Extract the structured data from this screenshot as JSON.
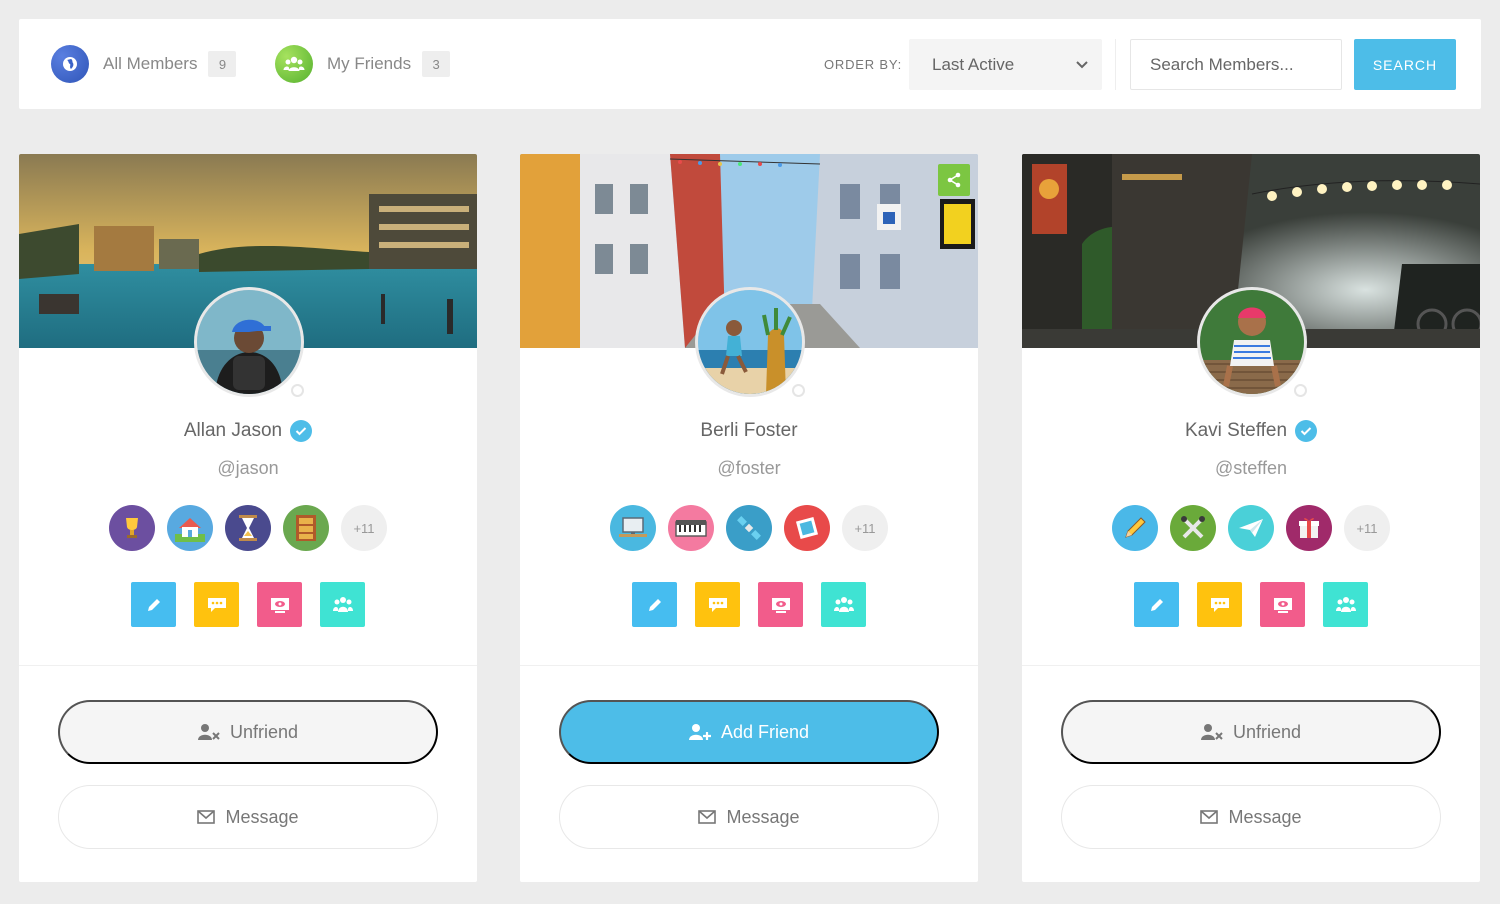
{
  "tabs": {
    "all": {
      "label": "All Members",
      "count": "9",
      "icon": "globe-icon"
    },
    "friends": {
      "label": "My Friends",
      "count": "3",
      "icon": "users-icon"
    }
  },
  "toolbar": {
    "order_label": "ORDER BY:",
    "order_value": "Last Active",
    "search_placeholder": "Search Members...",
    "search_label": "SEARCH"
  },
  "colors": {
    "accent": "#4dbde8",
    "action_blue": "#46bdf0",
    "action_yellow": "#ffc20e",
    "action_pink": "#f25c8b",
    "action_teal": "#3fe3d3"
  },
  "members": [
    {
      "name": "Allan Jason",
      "handle": "@jason",
      "verified": true,
      "badges": [
        "trophy-badge",
        "house-badge",
        "hourglass-badge",
        "bookshelf-badge"
      ],
      "more_badges": "+11",
      "primary_action": "Unfriend",
      "secondary_action": "Message"
    },
    {
      "name": "Berli Foster",
      "handle": "@foster",
      "verified": false,
      "badges": [
        "computer-badge",
        "keyboard-badge",
        "satellite-badge",
        "stamp-badge"
      ],
      "more_badges": "+11",
      "primary_action": "Add Friend",
      "secondary_action": "Message"
    },
    {
      "name": "Kavi Steffen",
      "handle": "@steffen",
      "verified": true,
      "badges": [
        "pencil-badge",
        "tools-badge",
        "paper-plane-badge",
        "gift-badge"
      ],
      "more_badges": "+11",
      "primary_action": "Unfriend",
      "secondary_action": "Message"
    }
  ]
}
